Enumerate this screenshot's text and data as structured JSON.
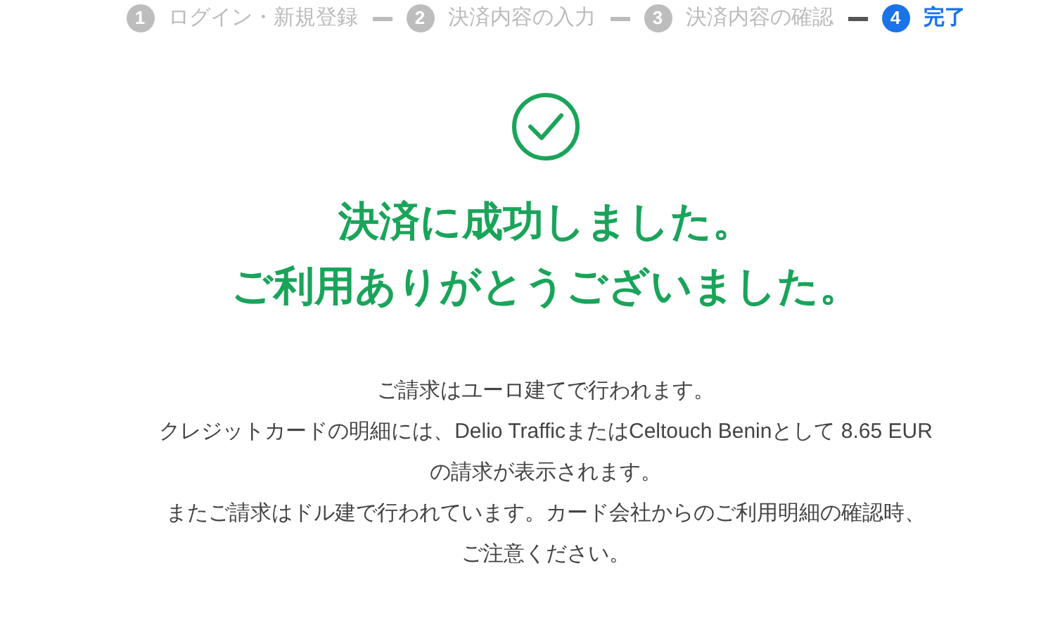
{
  "steps": [
    {
      "number": "1",
      "label": "ログイン・新規登録",
      "selected": false
    },
    {
      "number": "2",
      "label": "決済内容の入力",
      "selected": false
    },
    {
      "number": "3",
      "label": "決済内容の確認",
      "selected": false
    },
    {
      "number": "4",
      "label": "完了",
      "selected": true
    }
  ],
  "heading": [
    "決済に成功しました。",
    "ご利用ありがとうございました。"
  ],
  "paragraphs": [
    "ご請求はユーロ建てで行われます。",
    "クレジットカードの明細には、Delio TrafficまたはCeltouch Beninとして 8.65 EUR",
    "の請求が表示されます。",
    "またご請求はドル建で行われています。カード会社からのご利用明細の確認時、",
    "ご注意ください。"
  ]
}
